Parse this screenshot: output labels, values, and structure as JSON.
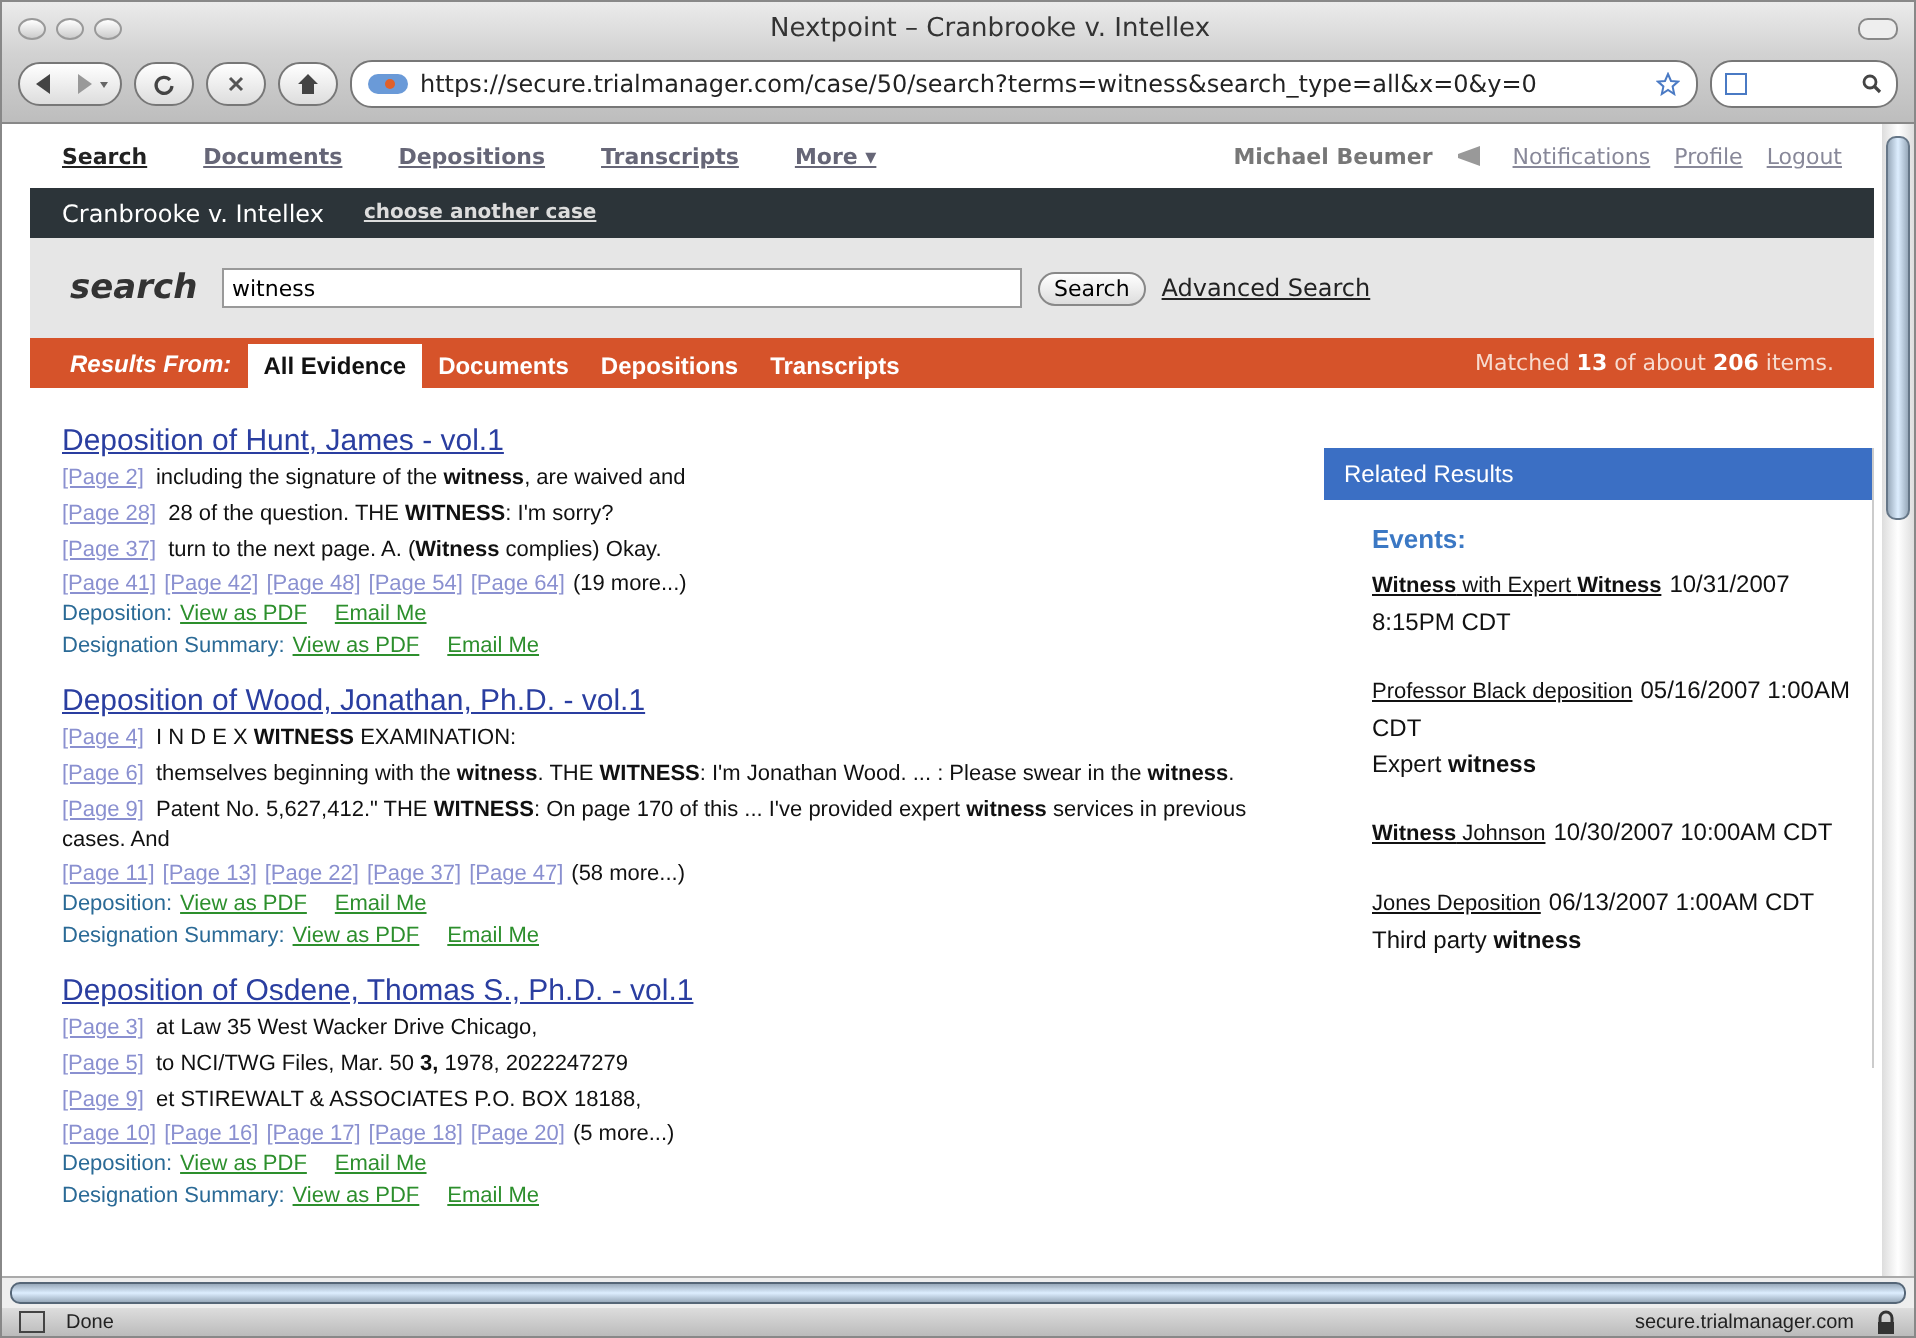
{
  "window": {
    "title": "Nextpoint – Cranbrooke v. Intellex"
  },
  "toolbar": {
    "url": "https://secure.trialmanager.com/case/50/search?terms=witness&search_type=all&x=0&y=0"
  },
  "nav": {
    "items": [
      {
        "label": "Search",
        "selected": true
      },
      {
        "label": "Documents",
        "selected": false
      },
      {
        "label": "Depositions",
        "selected": false
      },
      {
        "label": "Transcripts",
        "selected": false
      },
      {
        "label": "More ▾",
        "selected": false
      }
    ],
    "user": "Michael Beumer",
    "links": [
      "Notifications",
      "Profile",
      "Logout"
    ]
  },
  "case_bar": {
    "title": "Cranbrooke v. Intellex",
    "link": "choose another case"
  },
  "search": {
    "label": "search",
    "value": "witness",
    "button": "Search",
    "advanced": "Advanced Search"
  },
  "results_bar": {
    "label": "Results From:",
    "tabs": [
      {
        "label": "All Evidence",
        "selected": true
      },
      {
        "label": "Documents",
        "selected": false
      },
      {
        "label": "Depositions",
        "selected": false
      },
      {
        "label": "Transcripts",
        "selected": false
      }
    ],
    "matched": "Matched **13** of about **206** items."
  },
  "results": [
    {
      "title": "Deposition of Hunt, James - vol.1",
      "snippets": [
        {
          "page": "[Page 2]",
          "text": "including the signature of the **witness**, are waived and"
        },
        {
          "page": "[Page 28]",
          "text": "28 of the question. THE **WITNESS**: I'm sorry?"
        },
        {
          "page": "[Page 37]",
          "text": "turn to the next page. A. (**Witness** complies) Okay."
        }
      ],
      "pages": [
        "[Page 41]",
        "[Page 42]",
        "[Page 48]",
        "[Page 54]",
        "[Page 64]"
      ],
      "more": "(19 more...)",
      "actions": [
        {
          "label": "Deposition:",
          "links": [
            "View as PDF",
            "Email Me"
          ]
        },
        {
          "label": "Designation Summary:",
          "links": [
            "View as PDF",
            "Email Me"
          ]
        }
      ]
    },
    {
      "title": "Deposition of Wood, Jonathan, Ph.D. - vol.1",
      "snippets": [
        {
          "page": "[Page 4]",
          "text": "I N D E X **WITNESS** EXAMINATION:"
        },
        {
          "page": "[Page 6]",
          "text": "themselves beginning with the **witness**. THE **WITNESS**: I'm Jonathan Wood. ... : Please swear in the **witness**."
        },
        {
          "page": "[Page 9]",
          "text": "Patent No. 5,627,412.\" THE **WITNESS**: On page 170 of this ... I've provided expert **witness** services in previous cases. And"
        }
      ],
      "pages": [
        "[Page 11]",
        "[Page 13]",
        "[Page 22]",
        "[Page 37]",
        "[Page 47]"
      ],
      "more": "(58 more...)",
      "actions": [
        {
          "label": "Deposition:",
          "links": [
            "View as PDF",
            "Email Me"
          ]
        },
        {
          "label": "Designation Summary:",
          "links": [
            "View as PDF",
            "Email Me"
          ]
        }
      ]
    },
    {
      "title": "Deposition of Osdene, Thomas S., Ph.D. - vol.1",
      "snippets": [
        {
          "page": "[Page 3]",
          "text": "at Law 35 West Wacker Drive Chicago,"
        },
        {
          "page": "[Page 5]",
          "text": "to NCI/TWG Files, Mar. 50 **3,** 1978, 2022247279"
        },
        {
          "page": "[Page 9]",
          "text": "et STIREWALT & ASSOCIATES P.O. BOX 18188,"
        }
      ],
      "pages": [
        "[Page 10]",
        "[Page 16]",
        "[Page 17]",
        "[Page 18]",
        "[Page 20]"
      ],
      "more": "(5 more...)",
      "actions": [
        {
          "label": "Deposition:",
          "links": [
            "View as PDF",
            "Email Me"
          ]
        },
        {
          "label": "Designation Summary:",
          "links": [
            "View as PDF",
            "Email Me"
          ]
        }
      ]
    }
  ],
  "related": {
    "title": "Related Results",
    "section": "Events:",
    "events": [
      {
        "title": "**Witness** with Expert **Witness**",
        "date": "10/31/2007 8:15PM CDT"
      },
      {
        "title": "Professor Black deposition",
        "date": "05/16/2007 1:00AM CDT",
        "note": "Expert **witness**"
      },
      {
        "title": "**Witness** Johnson",
        "date": "10/30/2007 10:00AM CDT"
      },
      {
        "title": "Jones Deposition",
        "date": "06/13/2007 1:00AM CDT",
        "note": "Third party **witness**"
      }
    ]
  },
  "status_bar": {
    "text": "Done",
    "host": "secure.trialmanager.com"
  }
}
